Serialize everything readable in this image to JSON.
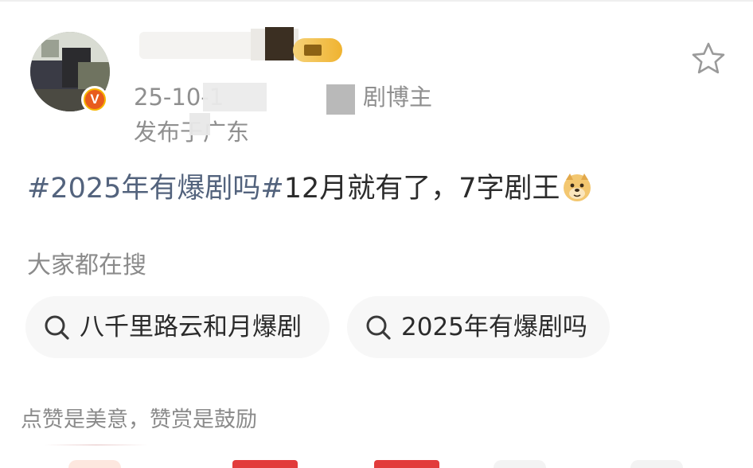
{
  "post": {
    "meta_time": "25-10-1",
    "meta_role": "剧博主",
    "location_prefix": "发布于",
    "location_suffix": "东",
    "location_mid": "广",
    "hashtag": "#2025年有爆剧吗#",
    "text": "12月就有了，7字剧王",
    "emoji": "doge-emoji"
  },
  "search": {
    "title": "大家都在搜",
    "chips": [
      {
        "label": "八千里路云和月爆剧",
        "icon": "search-icon"
      },
      {
        "label": "2025年有爆剧吗",
        "icon": "search-icon"
      }
    ]
  },
  "reward": {
    "text": "点赞是美意，赞赏是鼓励"
  },
  "icons": {
    "favorite": "star-outline-icon",
    "verified": "verified-v-icon"
  },
  "colors": {
    "hashtag": "#53637d",
    "muted": "#8f8f8f",
    "verified_badge": "#f7b500"
  }
}
